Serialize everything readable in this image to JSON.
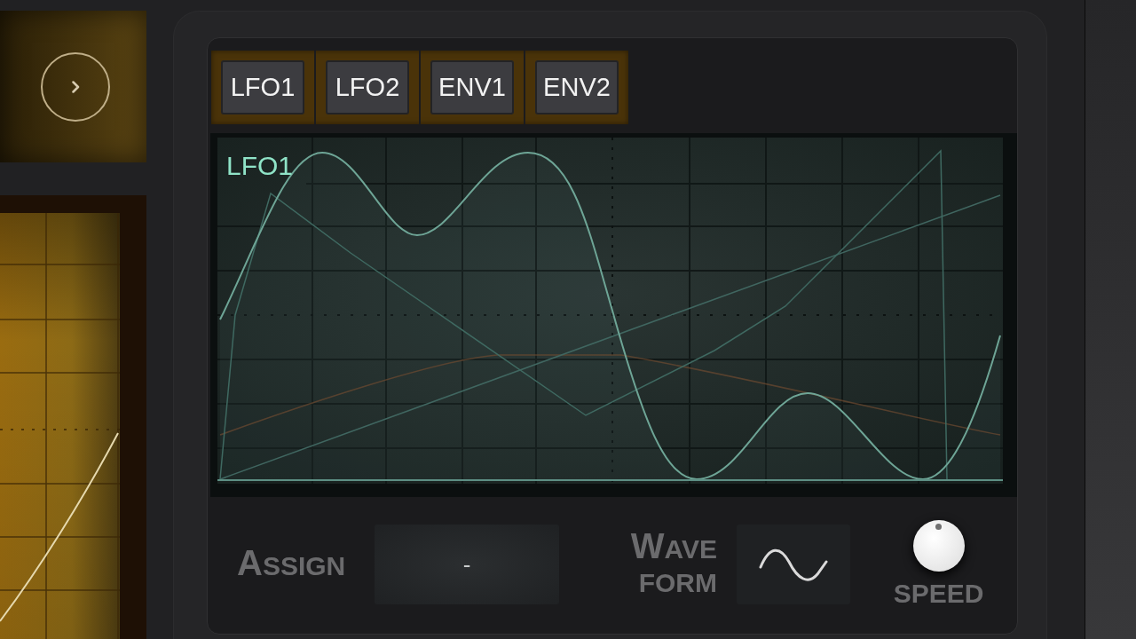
{
  "tabs": [
    {
      "label": "LFO1"
    },
    {
      "label": "LFO2"
    },
    {
      "label": "ENV1"
    },
    {
      "label": "ENV2"
    }
  ],
  "display": {
    "label": "LFO1"
  },
  "assign": {
    "label": "ASSIGN",
    "value": "-"
  },
  "waveform": {
    "label": "WAVE FORM"
  },
  "speed": {
    "label": "SPEED",
    "level": 0.5
  }
}
